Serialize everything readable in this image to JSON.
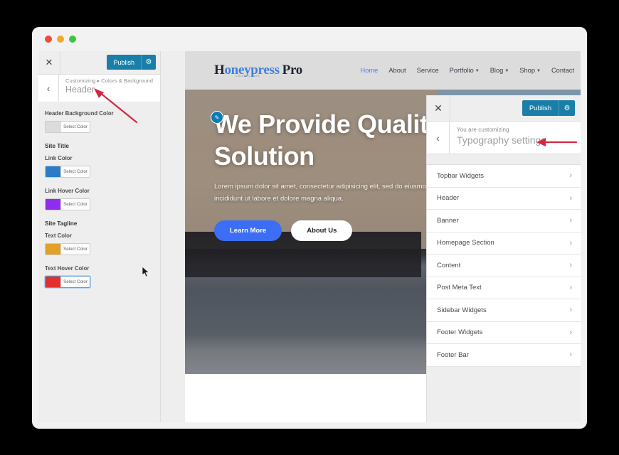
{
  "window": {
    "traffic_lights": [
      "red",
      "yellow",
      "green"
    ]
  },
  "left_panel": {
    "close_icon": "close-icon",
    "publish_label": "Publish",
    "gear_icon": "gear-icon",
    "back_icon": "back-chevron-icon",
    "breadcrumb_prefix": "Customizing",
    "breadcrumb_separator": "▸",
    "breadcrumb_section": "Colors & Background",
    "title": "Header",
    "sections": [
      {
        "label": "Header Background Color",
        "type": "field",
        "swatch": "#dcdcdc",
        "button_label": "Select Color",
        "focused": false
      },
      {
        "label": "Site Title",
        "type": "group"
      },
      {
        "label": "Link Color",
        "type": "field",
        "swatch": "#2a7cc7",
        "button_label": "Select Color",
        "focused": false
      },
      {
        "label": "Link Hover Color",
        "type": "field",
        "swatch": "#8f2cf0",
        "button_label": "Select Color",
        "focused": false
      },
      {
        "label": "Site Tagline",
        "type": "group"
      },
      {
        "label": "Text Color",
        "type": "field",
        "swatch": "#e0a029",
        "button_label": "Select Color",
        "focused": false
      },
      {
        "label": "Text Hover Color",
        "type": "field",
        "swatch": "#e03030",
        "button_label": "Select Color",
        "focused": true
      }
    ]
  },
  "preview": {
    "brand": {
      "part1": "H",
      "part2": "oneypress",
      "part3": "Pro",
      "tagline": "A Business Theme"
    },
    "nav": [
      {
        "label": "Home",
        "active": true,
        "dropdown": false
      },
      {
        "label": "About",
        "active": false,
        "dropdown": false
      },
      {
        "label": "Service",
        "active": false,
        "dropdown": false
      },
      {
        "label": "Portfolio",
        "active": false,
        "dropdown": true
      },
      {
        "label": "Blog",
        "active": false,
        "dropdown": true
      },
      {
        "label": "Shop",
        "active": false,
        "dropdown": true
      },
      {
        "label": "Contact",
        "active": false,
        "dropdown": false
      }
    ],
    "hero": {
      "edit_icon": "pencil-edit-icon",
      "title": "We Provide Quality Solution",
      "subtitle": "Lorem ipsum dolor sit amet, consectetur adipisicing elit, sed do eiusmod tempor incididunt ut labore et dolore magna aliqua.",
      "primary_button": "Learn More",
      "secondary_button": "About Us"
    }
  },
  "right_panel": {
    "close_icon": "close-icon",
    "publish_label": "Publish",
    "gear_icon": "gear-icon",
    "back_icon": "back-chevron-icon",
    "subtitle": "You are customizing",
    "title": "Typography settings",
    "items": [
      {
        "label": "Topbar Widgets"
      },
      {
        "label": "Header"
      },
      {
        "label": "Banner"
      },
      {
        "label": "Homepage Section"
      },
      {
        "label": "Content"
      },
      {
        "label": "Post Meta Text"
      },
      {
        "label": "Sidebar Widgets"
      },
      {
        "label": "Footer Widgets"
      },
      {
        "label": "Footer Bar"
      }
    ],
    "chevron_icon": "chevron-right-icon"
  },
  "annotations": {
    "color": "#d2293f",
    "left_arrow_target": "Colors & Background breadcrumb",
    "right_arrow_target": "Typography settings title"
  },
  "colors": {
    "publish_blue": "#1a7fa8",
    "nav_active_blue": "#4a7ff0",
    "hero_button_blue": "#3b6ef5",
    "annotation_red": "#d2293f"
  }
}
